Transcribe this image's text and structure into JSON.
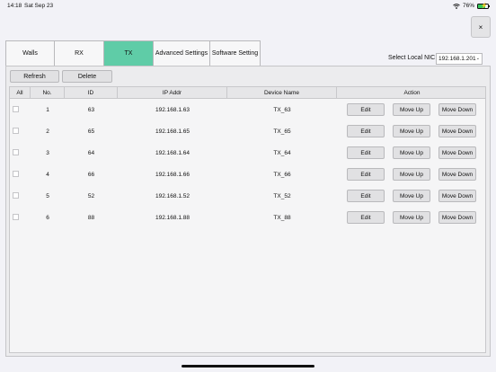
{
  "status_bar": {
    "time": "14:18",
    "date": "Sat Sep 23",
    "battery_percent": "76%",
    "battery_level": 0.76,
    "icons": [
      "wifi-icon",
      "battery-charging-icon"
    ]
  },
  "close_button": {
    "label": "×"
  },
  "tabs": [
    {
      "label": "Walls",
      "active": false
    },
    {
      "label": "RX",
      "active": false
    },
    {
      "label": "TX",
      "active": true
    },
    {
      "label": "Advanced Settings",
      "active": false
    },
    {
      "label": "Software Setting",
      "active": false
    }
  ],
  "nic": {
    "label": "Select Local NIC",
    "value": "192.168.1.201"
  },
  "toolbar": {
    "refresh_label": "Refresh",
    "delete_label": "Delete"
  },
  "table": {
    "headers": [
      "All",
      "No.",
      "ID",
      "IP Addr",
      "Device Name",
      "Action"
    ],
    "action_labels": {
      "edit": "Edit",
      "move_up": "Move Up",
      "move_down": "Move Down"
    },
    "rows": [
      {
        "no": "1",
        "id": "63",
        "ip": "192.168.1.63",
        "name": "TX_63"
      },
      {
        "no": "2",
        "id": "65",
        "ip": "192.168.1.65",
        "name": "TX_65"
      },
      {
        "no": "3",
        "id": "64",
        "ip": "192.168.1.64",
        "name": "TX_64"
      },
      {
        "no": "4",
        "id": "66",
        "ip": "192.168.1.66",
        "name": "TX_66"
      },
      {
        "no": "5",
        "id": "52",
        "ip": "192.168.1.52",
        "name": "TX_52"
      },
      {
        "no": "6",
        "id": "88",
        "ip": "192.168.1.88",
        "name": "TX_88"
      }
    ]
  },
  "colors": {
    "active_tab": "#5fcca7",
    "battery": "#34c759"
  }
}
